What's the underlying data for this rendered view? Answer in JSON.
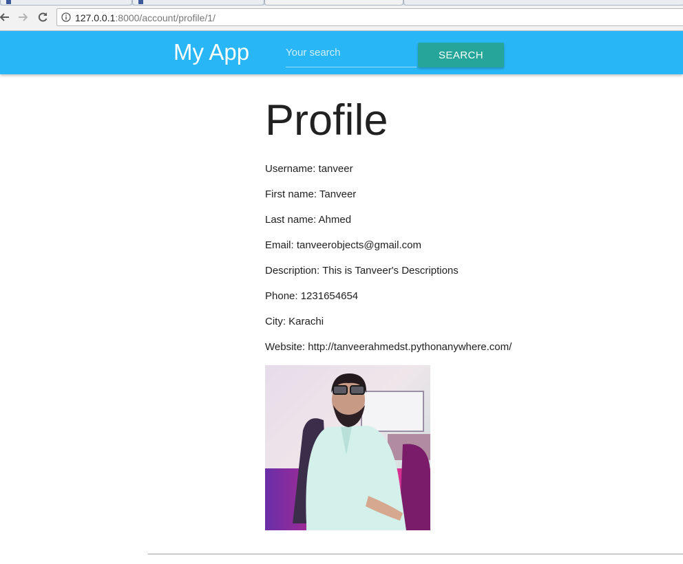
{
  "browser": {
    "url_host": "127.0.0.1",
    "url_rest": ":8000/account/profile/1/"
  },
  "navbar": {
    "brand": "My App",
    "search_placeholder": "Your search",
    "search_button": "SEARCH",
    "bar_color": "#29b6f6",
    "button_color": "#26a69a"
  },
  "profile": {
    "title": "Profile",
    "fields": [
      "Username: tanveer",
      "First name: Tanveer",
      "Last name: Ahmed",
      "Email: tanveerobjects@gmail.com",
      "Description: This is Tanveer's Descriptions",
      "Phone: 1231654654",
      "City: Karachi",
      "Website: http://tanveerahmedst.pythonanywhere.com/"
    ]
  }
}
